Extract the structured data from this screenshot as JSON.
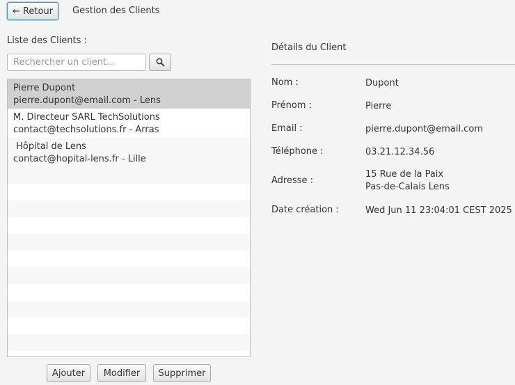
{
  "header": {
    "back_label": "← Retour",
    "title": "Gestion des Clients"
  },
  "list": {
    "label": "Liste des Clients :",
    "search_placeholder": "Rechercher un client...",
    "clients": [
      {
        "name": "Pierre Dupont",
        "info": "pierre.dupont@email.com - Lens",
        "selected": true
      },
      {
        "name": "M. Directeur SARL TechSolutions",
        "info": "contact@techsolutions.fr - Arras",
        "selected": false
      },
      {
        "name": " Hôpital de Lens",
        "info": "contact@hopital-lens.fr - Lille",
        "selected": false
      }
    ]
  },
  "actions": {
    "add": "Ajouter",
    "edit": "Modifier",
    "delete": "Supprimer"
  },
  "details": {
    "title": "Détails du Client",
    "nom_label": "Nom :",
    "nom": "Dupont",
    "prenom_label": "Prénom :",
    "prenom": "Pierre",
    "email_label": "Email :",
    "email": "pierre.dupont@email.com",
    "telephone_label": "Téléphone :",
    "telephone": "03.21.12.34.56",
    "adresse_label": "Adresse :",
    "adresse_line1": "15 Rue de la Paix",
    "adresse_line2": "Pas-de-Calais Lens",
    "date_label": "Date création :",
    "date": "Wed Jun 11 23:04:01 CEST 2025"
  },
  "icons": {
    "search": "search-icon"
  }
}
